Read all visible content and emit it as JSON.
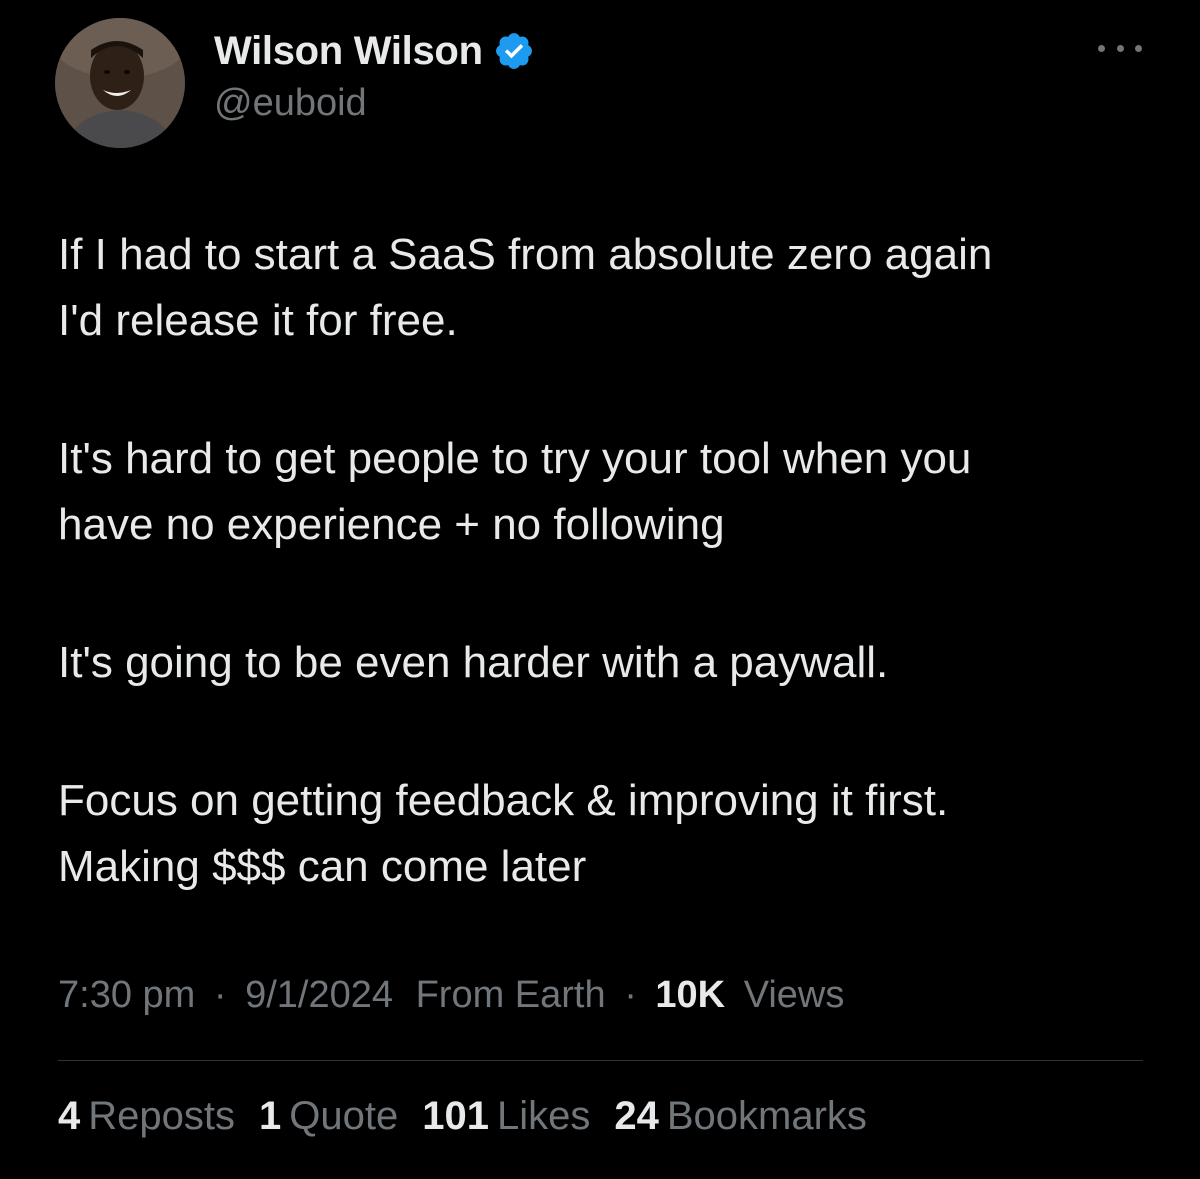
{
  "author": {
    "display_name": "Wilson Wilson",
    "handle": "@euboid",
    "verified": true,
    "verified_color": "#1d9bf0"
  },
  "tweet": {
    "paragraphs": [
      [
        "If I had to start a SaaS from absolute zero again",
        "I'd release it for free."
      ],
      [
        "It's hard to get people to try your tool when you",
        "have no experience + no following"
      ],
      [
        "It's going to be even harder with a paywall."
      ],
      [
        "Focus on getting feedback & improving it first.",
        "Making $$$ can come later"
      ]
    ]
  },
  "meta": {
    "time": "7:30 pm",
    "separator": "·",
    "date": "9/1/2024",
    "location": "From Earth",
    "views_count": "10K",
    "views_label": "Views"
  },
  "stats": [
    {
      "count": "4",
      "label": "Reposts"
    },
    {
      "count": "1",
      "label": "Quote"
    },
    {
      "count": "101",
      "label": "Likes"
    },
    {
      "count": "24",
      "label": "Bookmarks"
    }
  ],
  "colors": {
    "background": "#000000",
    "text_primary": "#e7e9ea",
    "text_secondary": "#71767b",
    "divider": "#2f3336"
  },
  "icons": {
    "more": "more-horizontal-icon",
    "verified": "verified-badge-icon"
  }
}
